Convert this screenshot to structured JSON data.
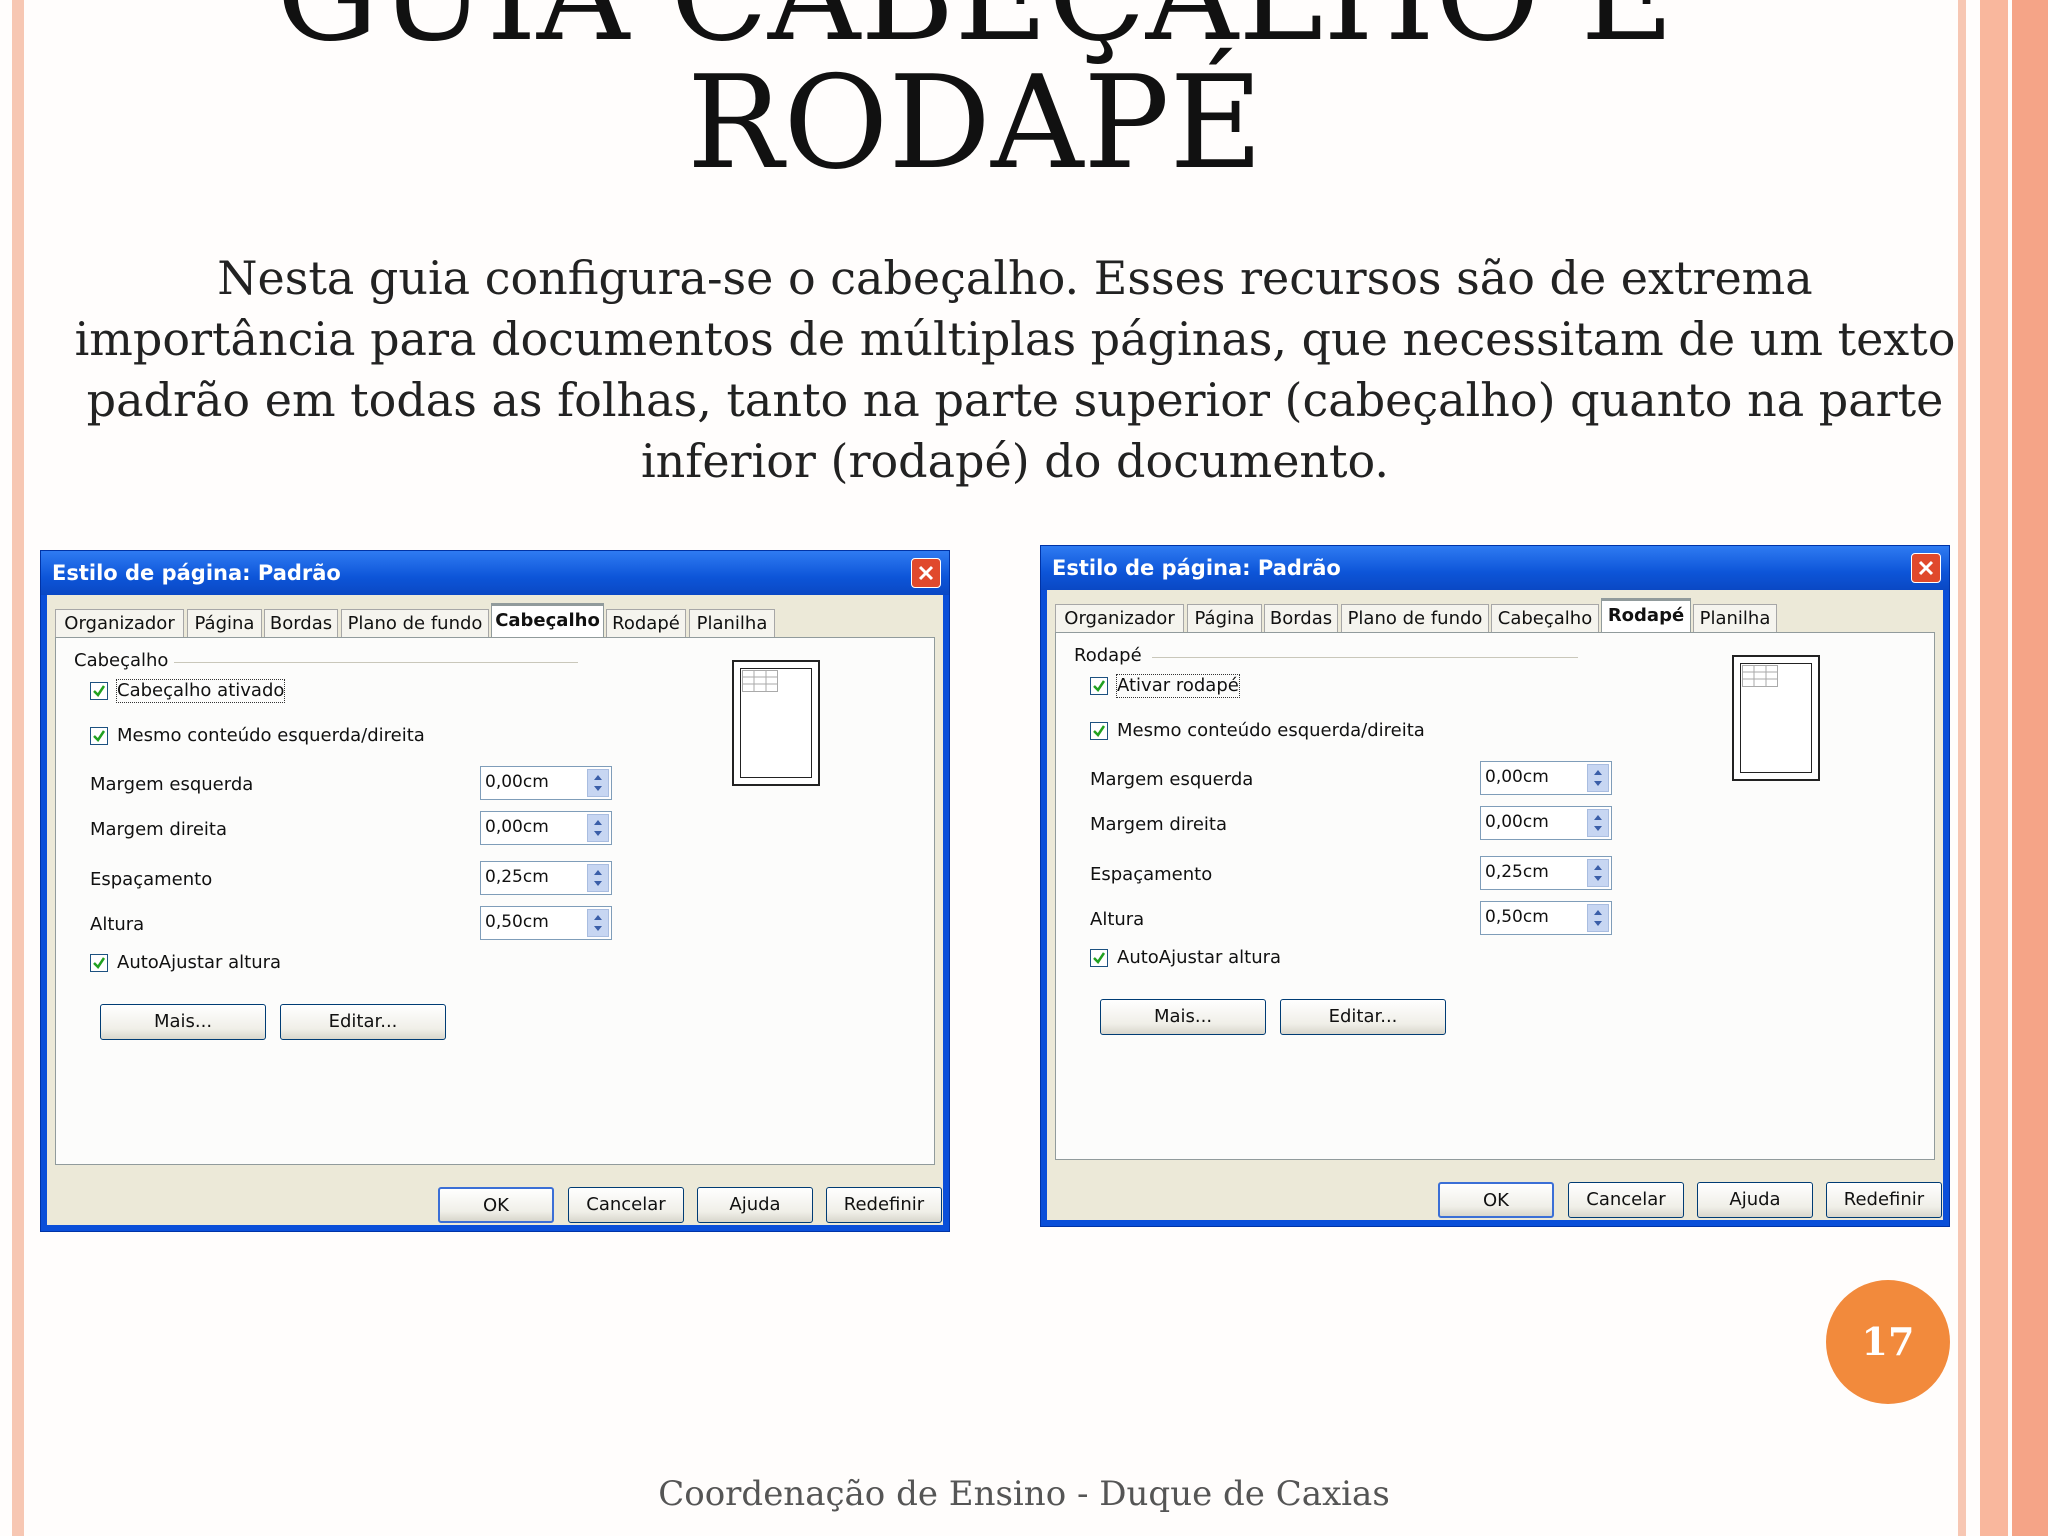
{
  "slide": {
    "title_line1": "GUIA CABEÇALHO E",
    "title_line2": "RODAPÉ",
    "paragraph": "Nesta guia configura-se o cabeçalho. Esses recursos são de extrema importância para documentos de múltiplas páginas, que necessitam de um texto padrão em todas as folhas, tanto na parte superior (cabeçalho) quanto na parte inferior (rodapé) do documento.",
    "page_number": "17",
    "footer": "Coordenação de Ensino - Duque de Caxias",
    "accent_color": "#f28a3c"
  },
  "dialogs": [
    {
      "title": "Estilo de página: Padrão",
      "tabs": [
        "Organizador",
        "Página",
        "Bordas",
        "Plano de fundo",
        "Cabeçalho",
        "Rodapé",
        "Planilha"
      ],
      "active_tab": "Cabeçalho",
      "group_label": "Cabeçalho",
      "enable_checkbox": "Cabeçalho ativado",
      "same_content_checkbox": "Mesmo conteúdo esquerda/direita",
      "margin_left_label": "Margem esquerda",
      "margin_left_value": "0,00cm",
      "margin_right_label": "Margem direita",
      "margin_right_value": "0,00cm",
      "spacing_label": "Espaçamento",
      "spacing_value": "0,25cm",
      "height_label": "Altura",
      "height_value": "0,50cm",
      "autofit_checkbox": "AutoAjustar altura",
      "more_button": "Mais...",
      "edit_button": "Editar...",
      "ok_button": "OK",
      "cancel_button": "Cancelar",
      "help_button": "Ajuda",
      "reset_button": "Redefinir"
    },
    {
      "title": "Estilo de página: Padrão",
      "tabs": [
        "Organizador",
        "Página",
        "Bordas",
        "Plano de fundo",
        "Cabeçalho",
        "Rodapé",
        "Planilha"
      ],
      "active_tab": "Rodapé",
      "group_label": "Rodapé",
      "enable_checkbox": "Ativar rodapé",
      "same_content_checkbox": "Mesmo conteúdo esquerda/direita",
      "margin_left_label": "Margem esquerda",
      "margin_left_value": "0,00cm",
      "margin_right_label": "Margem direita",
      "margin_right_value": "0,00cm",
      "spacing_label": "Espaçamento",
      "spacing_value": "0,25cm",
      "height_label": "Altura",
      "height_value": "0,50cm",
      "autofit_checkbox": "AutoAjustar altura",
      "more_button": "Mais...",
      "edit_button": "Editar...",
      "ok_button": "OK",
      "cancel_button": "Cancelar",
      "help_button": "Ajuda",
      "reset_button": "Redefinir"
    }
  ]
}
